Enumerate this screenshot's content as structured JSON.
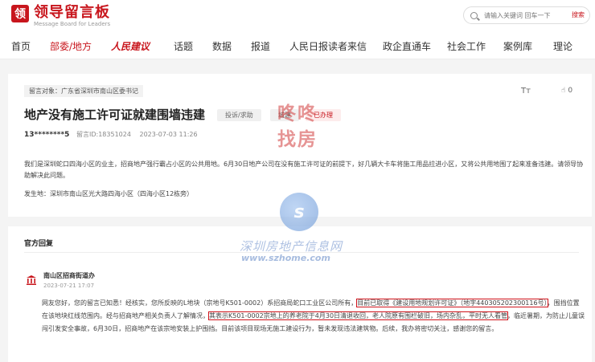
{
  "header": {
    "logo_mark": "领",
    "logo_title": "领导留言板",
    "logo_sub": "Message Board for Leaders",
    "search_placeholder": "请输入关键词 回车一下",
    "search_button": "搜索"
  },
  "nav": [
    "首页",
    "部委/地方",
    "人民建议",
    "话题",
    "数据",
    "报道",
    "人民日报读者来信",
    "政企直通车",
    "社会工作",
    "案例库",
    "理论"
  ],
  "message": {
    "target": "留言对象：广东省深圳市南山区委书记",
    "title": "地产没有施工许可证就建围墙违建",
    "tags": [
      "投诉/求助",
      "城建",
      "已办理"
    ],
    "user_id": "13********5",
    "msg_id": "留言ID:18351024",
    "time": "2023-07-03 11:26",
    "body": "我们是深圳蛇口四海小区的业主，招商地产强行霸占小区的公共用地。6月30日地产公司在没有施工许可证的前提下，好几辆大卡车将施工用品拉进小区，又将公共用地围了起来准备违建。请领导协助解决此问题。",
    "location": "发生地：深圳市南山区光大路四海小区（四海小区12栋旁）",
    "font_size_icon": "Tт",
    "likes": "0"
  },
  "reply": {
    "section_title": "官方回复",
    "org": "南山区招商街道办",
    "time": "2023-07-21 17:07",
    "p1": "网友您好，您的留言已知悉！经核实，您所反映的L地块（宗地号K501-0002）系招商局蛇口工业区公司所有，",
    "h1": "目前已取得《建设用地规划许可证》（地字440305202300116号）",
    "p2": "，围挡位置在该地块红线范围内。经与招商地产相关负责人了解情况，",
    "h2": "其表示K501-0002宗地上的养老院于4月30日清退收回，老人院原有围栏破旧，场内杂乱，平时无人看管",
    "p3": "，临近暑期，为防止儿童误闯引发安全事故，6月30日，招商地产在该宗地安装上护围挡。目前该项目现场无施工建设行为，暂未发现违法建筑物。后续，我办将密切关注，感谢您的留言。"
  },
  "watermark": {
    "lq1": "咚咚",
    "lq2": "找房",
    "logo_char": "s",
    "name": "深圳房地产信息网",
    "url": "www.szhome.com"
  }
}
